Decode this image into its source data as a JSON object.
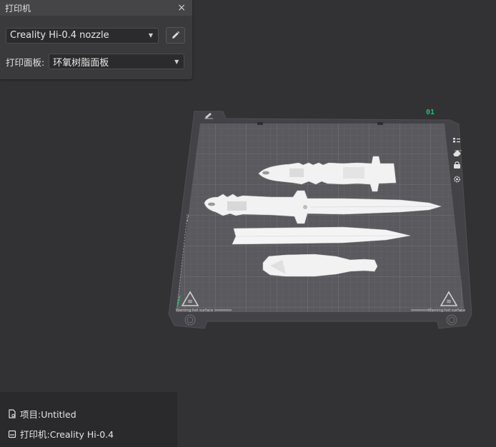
{
  "printer_panel": {
    "title": "打印机",
    "close_glyph": "×",
    "printer_select": "Creality Hi-0.4 nozzle",
    "plate_label": "打印面板:",
    "plate_select": "环氧树脂面板"
  },
  "plate": {
    "plate_number": "01",
    "warning_text": "Warning:hot surface"
  },
  "info_panel": {
    "project": "项目:Untitled",
    "printer": "打印机:Creality Hi-0.4"
  },
  "colors": {
    "accent_green": "#19c26a",
    "background": "#323234",
    "plate_surface": "#5a5a5e",
    "model": "#f2f2f2"
  },
  "icons": {
    "edit": "pencil-icon",
    "object_list": "list-icon",
    "erase": "eraser-icon",
    "lock": "lock-icon",
    "settings": "gear-icon",
    "plate_edit": "plate-edit-icon",
    "project": "file-icon",
    "printer": "printer-icon"
  }
}
